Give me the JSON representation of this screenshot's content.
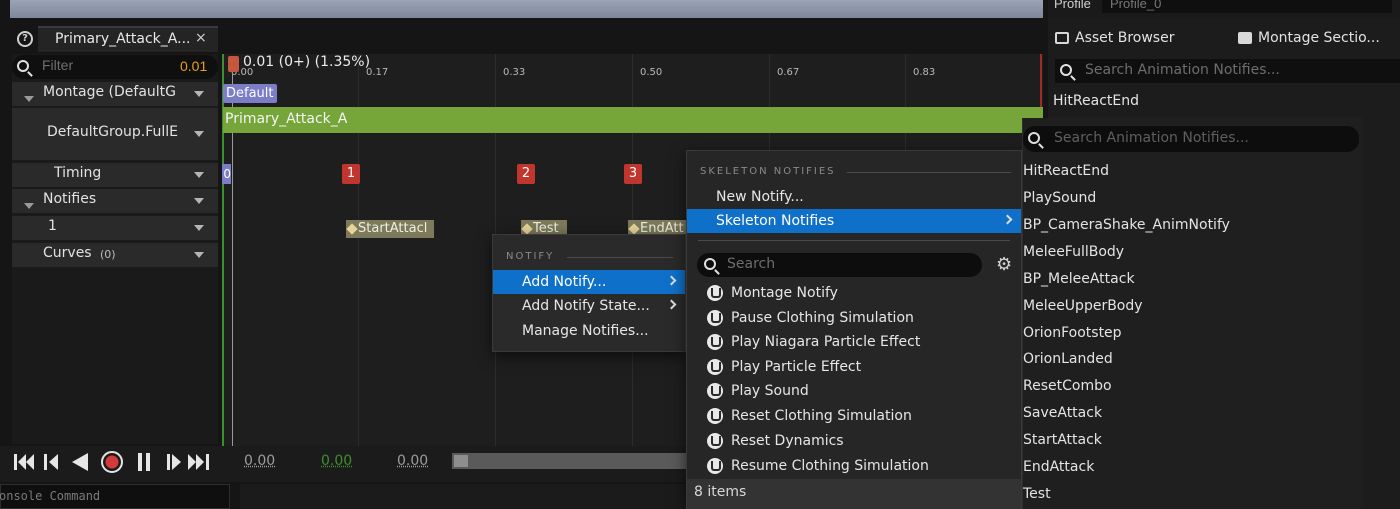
{
  "top_right": {
    "profile_label": "Profile",
    "profile_value": "Profile_0"
  },
  "tab": {
    "title": "Primary_Attack_A...",
    "close": "×"
  },
  "filter": {
    "placeholder": "Filter",
    "value": "0.01"
  },
  "tracks": {
    "montage": "Montage (DefaultG",
    "slot": "DefaultGroup.FullE",
    "timing": "Timing",
    "notifies": "Notifies",
    "notify_track": "1",
    "curves": "Curves",
    "curves_count": "(0)"
  },
  "timeline": {
    "scrubber_label": "0.01 (0+) (1.35%)",
    "ticks": [
      "0.00",
      "0.17",
      "0.33",
      "0.50",
      "0.67",
      "0.83"
    ],
    "default_section": "Default",
    "slot_segment": "Primary_Attack_A",
    "timing_first": "0",
    "section_badges": [
      "1",
      "2",
      "3"
    ],
    "notifies": [
      "StartAttacl",
      "Test",
      "EndAtt"
    ]
  },
  "transport": {
    "time_1": "0.00",
    "time_2": "0.00",
    "time_3": "0.00"
  },
  "console": {
    "placeholder": "onsole Command"
  },
  "right_panel": {
    "asset_browser": "Asset Browser",
    "montage_sections": "Montage Sectio...",
    "search_placeholder": "Search Animation Notifies...",
    "first_item": "HitReactEnd"
  },
  "notify_menu": {
    "header": "NOTIFY",
    "items": [
      "Add Notify...",
      "Add Notify State...",
      "Manage Notifies..."
    ]
  },
  "skeleton_menu": {
    "header": "SKELETON NOTIFIES",
    "new_notify": "New Notify...",
    "skeleton_notifies": "Skeleton Notifies",
    "search_placeholder": "Search",
    "items": [
      "Montage Notify",
      "Pause Clothing Simulation",
      "Play Niagara Particle Effect",
      "Play Particle Effect",
      "Play Sound",
      "Reset Clothing Simulation",
      "Reset Dynamics",
      "Resume Clothing Simulation"
    ],
    "count": "8 items"
  },
  "skeleton_submenu": {
    "search_placeholder": "Search Animation Notifies...",
    "items": [
      "HitReactEnd",
      "PlaySound",
      "BP_CameraShake_AnimNotify",
      "MeleeFullBody",
      "BP_MeleeAttack",
      "MeleeUpperBody",
      "OrionFootstep",
      "OrionLanded",
      "ResetCombo",
      "SaveAttack",
      "StartAttack",
      "EndAttack",
      "Test"
    ]
  },
  "colors": {
    "accent_blue": "#0e70c8",
    "slot_green": "#76a53a",
    "section_red": "#c0352e",
    "default_purple": "#7b7dc7",
    "notify_olive": "#7d7a5b",
    "filter_orange": "#e5a020"
  }
}
